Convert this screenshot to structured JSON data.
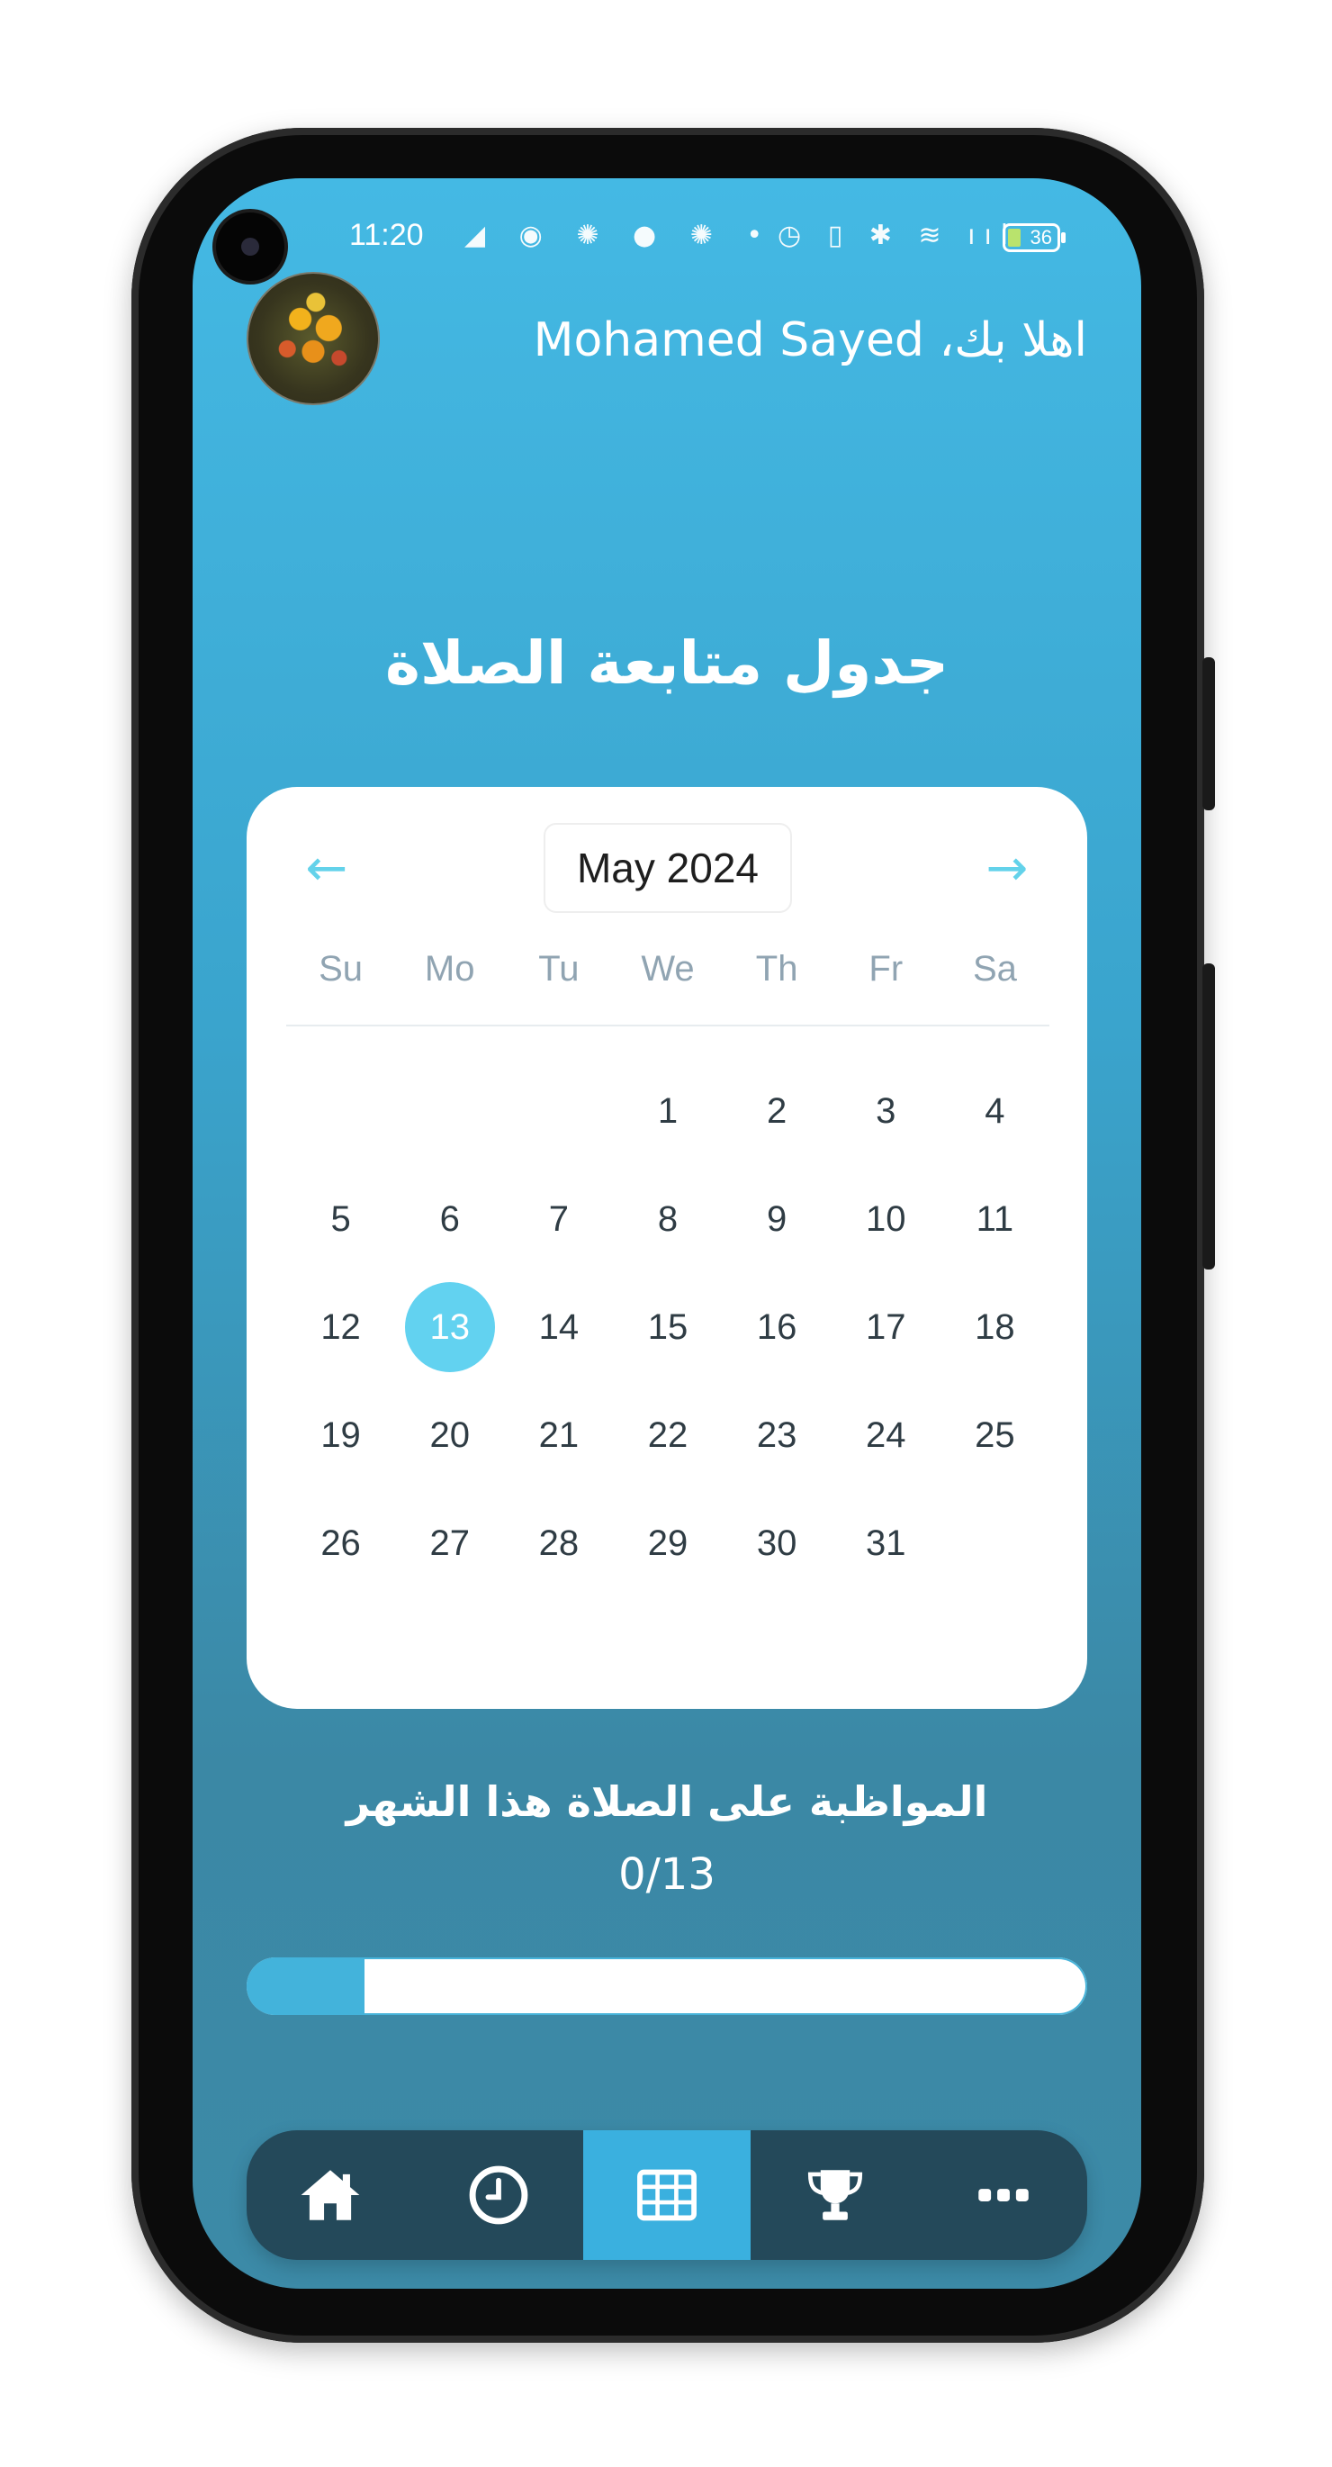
{
  "status_bar": {
    "time": "11:20",
    "left_icons": "◢ ◉ ✺ ● ✺ •",
    "right_icons": "◷ ▯ ✱ ≋ ııl",
    "battery": "36"
  },
  "header": {
    "greeting": "اهلا بك، Mohamed Sayed",
    "avatar_icon": "profile-photo"
  },
  "page_title": "جدول متابعة الصلاة",
  "calendar": {
    "prev_arrow": "←",
    "next_arrow": "→",
    "month_label": "May 2024",
    "weekdays": [
      "Su",
      "Mo",
      "Tu",
      "We",
      "Th",
      "Fr",
      "Sa"
    ],
    "days": [
      "",
      "",
      "",
      "1",
      "2",
      "3",
      "4",
      "5",
      "6",
      "7",
      "8",
      "9",
      "10",
      "11",
      "12",
      "13",
      "14",
      "15",
      "16",
      "17",
      "18",
      "19",
      "20",
      "21",
      "22",
      "23",
      "24",
      "25",
      "26",
      "27",
      "28",
      "29",
      "30",
      "31",
      ""
    ],
    "selected_day": "13",
    "accent_color": "#62d2f0"
  },
  "consistency": {
    "label": "المواظبة على الصلاة هذا الشهر",
    "count": "0/13",
    "progress_fraction": 0.14
  },
  "bottom_nav": {
    "items": [
      {
        "icon": "home-icon",
        "active": false
      },
      {
        "icon": "clock-icon",
        "active": false
      },
      {
        "icon": "table-icon",
        "active": true
      },
      {
        "icon": "trophy-icon",
        "active": false
      },
      {
        "icon": "more-icon",
        "active": false
      }
    ],
    "active_color": "#3ab0df",
    "background_color": "#24495a"
  }
}
